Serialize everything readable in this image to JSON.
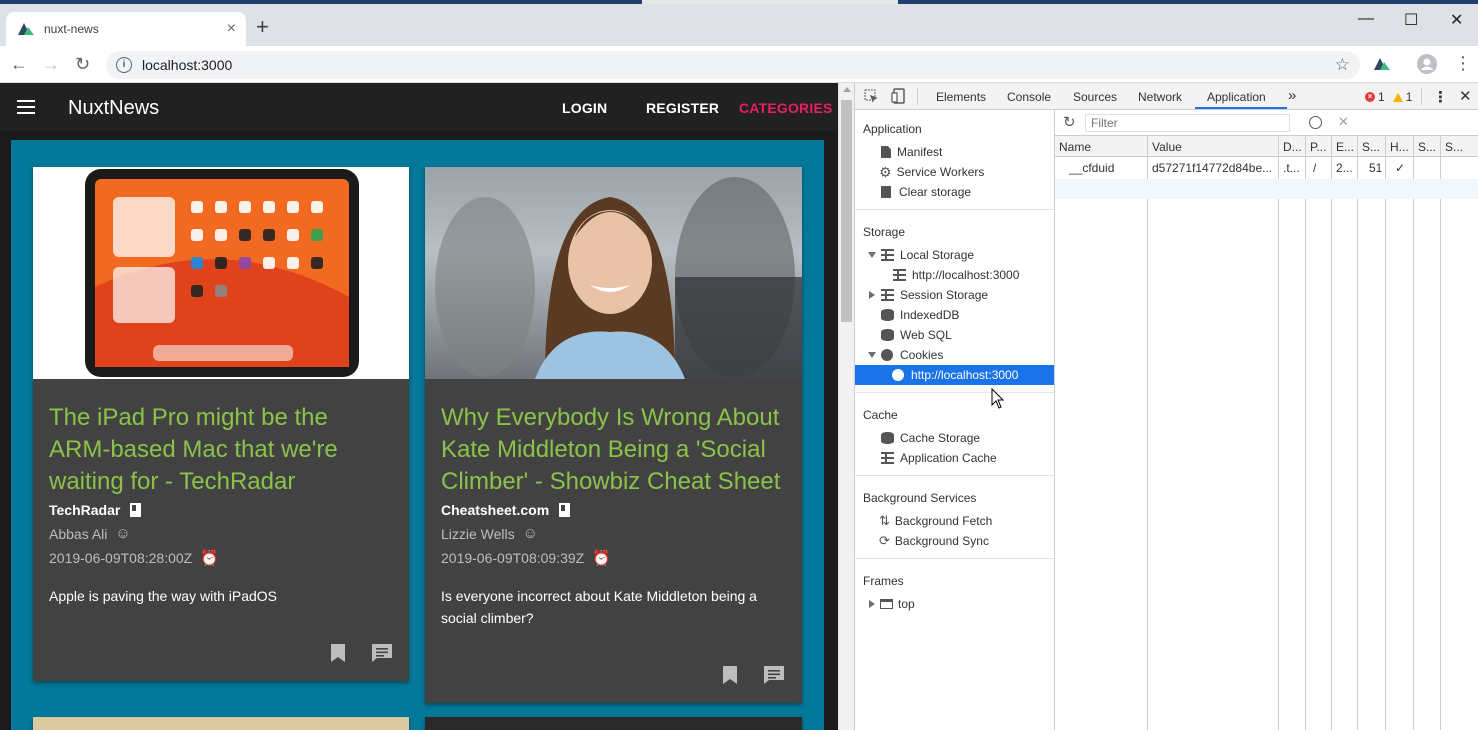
{
  "browser": {
    "tab_title": "nuxt-news",
    "tab_close": "×",
    "new_tab": "+",
    "window": {
      "minimize": "—",
      "maximize": "☐",
      "close": "✕"
    },
    "nav": {
      "back": "←",
      "forward": "→",
      "reload": "↻"
    },
    "url": "localhost:3000",
    "bookmark_star": "☆",
    "menu": "⋮"
  },
  "app": {
    "brand": "NuxtNews",
    "nav": {
      "login": "LOGIN",
      "register": "REGISTER",
      "categories": "CATEGORIES"
    },
    "accent_color": "#e91e63",
    "background_color": "#02789a",
    "headline_color": "#8bc34a",
    "cards": [
      {
        "headline": "The iPad Pro might be the ARM-based Mac that we're waiting for - TechRadar",
        "source": "TechRadar",
        "author": "Abbas Ali",
        "date": "2019-06-09T08:28:00Z",
        "description": "Apple is paving the way with iPadOS"
      },
      {
        "headline": "Why Everybody Is Wrong About Kate Middleton Being a 'Social Climber' - Showbiz Cheat Sheet",
        "source": "Cheatsheet.com",
        "author": "Lizzie Wells",
        "date": "2019-06-09T08:09:39Z",
        "description": "Is everyone incorrect about Kate Middleton being a social climber?"
      }
    ]
  },
  "devtools": {
    "tabs": [
      "Elements",
      "Console",
      "Sources",
      "Network",
      "Application"
    ],
    "more_tabs": "»",
    "errors": "1",
    "warnings": "1",
    "filter_placeholder": "Filter",
    "sidebar": {
      "application": {
        "title": "Application",
        "items": [
          "Manifest",
          "Service Workers",
          "Clear storage"
        ]
      },
      "storage": {
        "title": "Storage",
        "local_storage": "Local Storage",
        "local_storage_origin": "http://localhost:3000",
        "session_storage": "Session Storage",
        "indexeddb": "IndexedDB",
        "websql": "Web SQL",
        "cookies": "Cookies",
        "cookies_origin": "http://localhost:3000"
      },
      "cache": {
        "title": "Cache",
        "items": [
          "Cache Storage",
          "Application Cache"
        ]
      },
      "background": {
        "title": "Background Services",
        "items": [
          "Background Fetch",
          "Background Sync"
        ]
      },
      "frames": {
        "title": "Frames",
        "top": "top"
      }
    },
    "cookie_table": {
      "headers": [
        "Name",
        "Value",
        "D...",
        "P...",
        "E...",
        "S...",
        "H...",
        "S...",
        "S..."
      ],
      "rows": [
        [
          "__cfduid",
          "d57271f14772d84be...",
          ".t...",
          "/",
          "2...",
          "51",
          "✓",
          "",
          ""
        ]
      ]
    }
  }
}
